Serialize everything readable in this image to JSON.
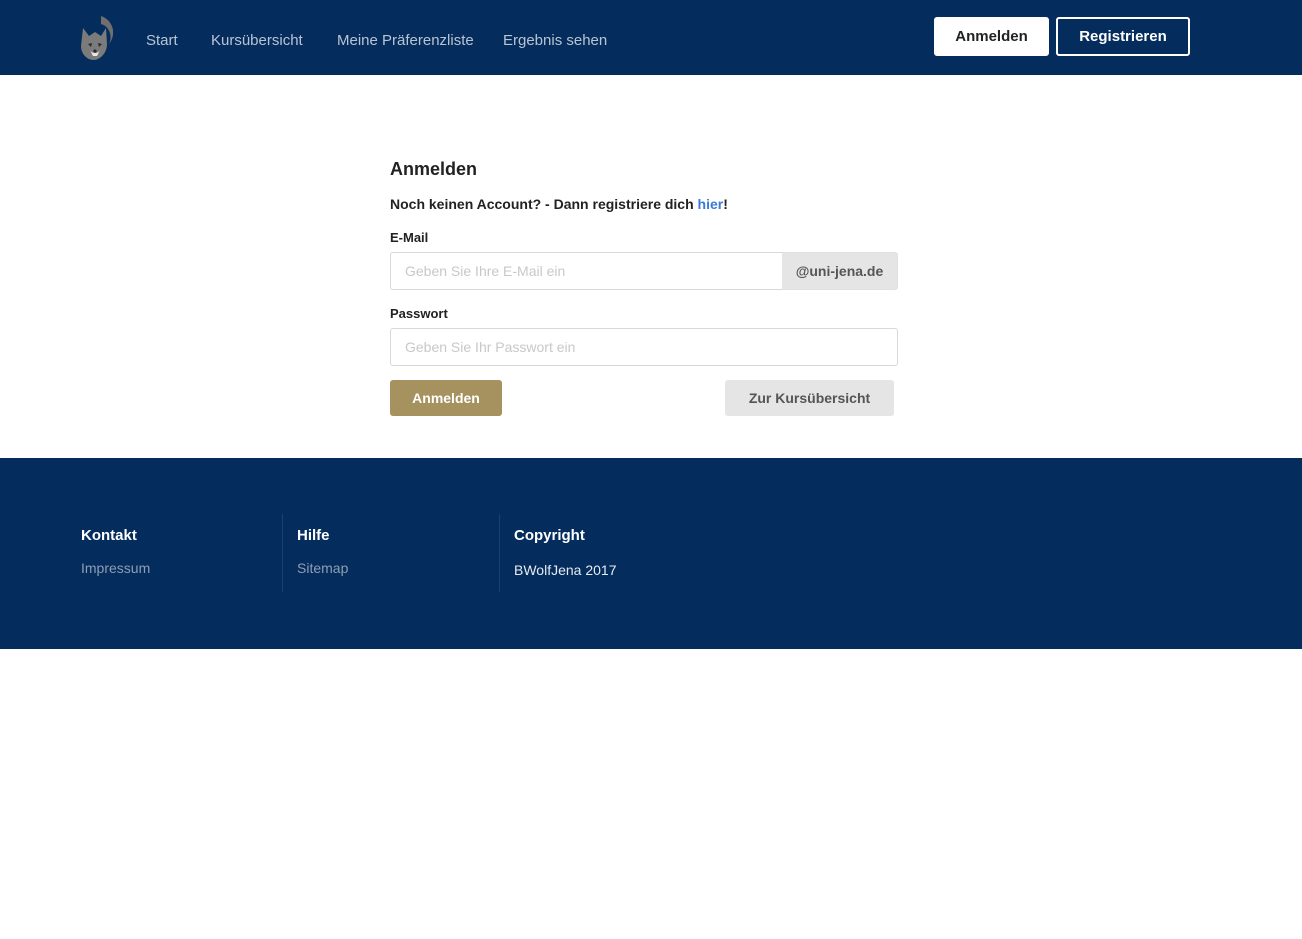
{
  "nav": {
    "links": [
      "Start",
      "Kursübersicht",
      "Meine Präferenzliste",
      "Ergebnis sehen"
    ],
    "login_label": "Anmelden",
    "register_label": "Registrieren"
  },
  "login": {
    "title": "Anmelden",
    "subtitle_prefix": "Noch keinen Account? - Dann registriere dich ",
    "subtitle_link": "hier",
    "subtitle_suffix": "!",
    "email_label": "E-Mail",
    "email_placeholder": "Geben Sie Ihre E-Mail ein",
    "email_domain": "@uni-jena.de",
    "password_label": "Passwort",
    "password_placeholder": "Geben Sie Ihr Passwort ein",
    "submit_label": "Anmelden",
    "courses_label": "Zur Kursübersicht"
  },
  "footer": {
    "contact_heading": "Kontakt",
    "contact_link": "Impressum",
    "help_heading": "Hilfe",
    "help_link": "Sitemap",
    "copyright_heading": "Copyright",
    "copyright_text": "BWolfJena 2017"
  },
  "colors": {
    "navbar": "#042c5c",
    "primary_button": "#a5925f",
    "link": "#3a7bd5"
  },
  "icons": {
    "logo": "wolf-logo-icon"
  }
}
